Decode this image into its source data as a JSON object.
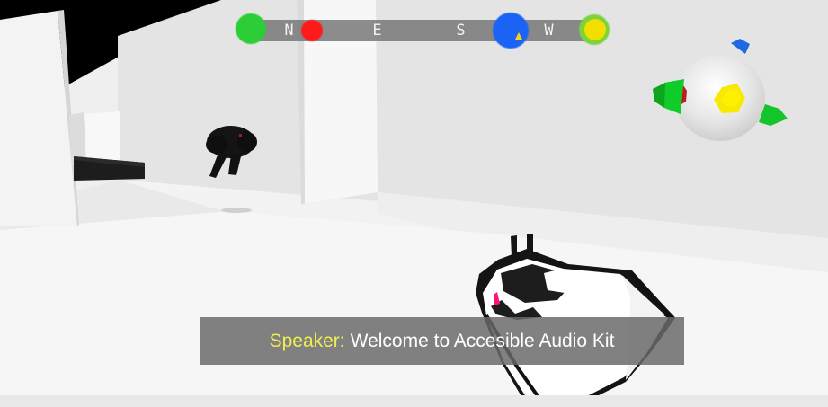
{
  "compass": {
    "labels": [
      "N",
      "E",
      "S",
      "W"
    ],
    "markers": [
      "green",
      "red",
      "blue",
      "yellow"
    ],
    "pointer_icon": "arrow-up-icon"
  },
  "subtitle": {
    "speaker": "Speaker:",
    "text": "Welcome to Accesible Audio Kit"
  },
  "colors": {
    "speaker": "#f1ef50",
    "green": "#2ccd36",
    "red": "#ff1a1a",
    "blue": "#1b63f5",
    "yellow": "#f0df00"
  }
}
